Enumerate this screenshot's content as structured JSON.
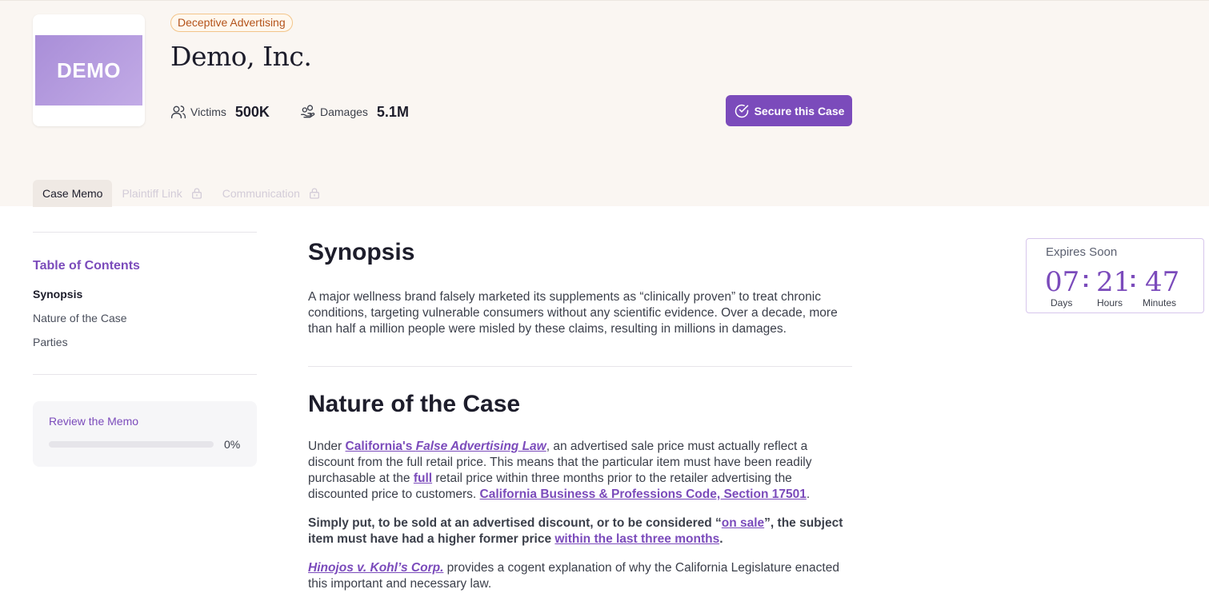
{
  "header": {
    "logo_text": "DEMO",
    "badge": "Deceptive Advertising",
    "company": "Demo, Inc.",
    "stats": [
      {
        "label": "Victims",
        "value": "500K",
        "icon": "users-icon"
      },
      {
        "label": "Damages",
        "value": "5.1M",
        "icon": "hand-coins-icon"
      }
    ],
    "secure_button": "Secure this Case"
  },
  "tabs": [
    {
      "label": "Case Memo",
      "active": true,
      "locked": false
    },
    {
      "label": "Plaintiff Link",
      "active": false,
      "locked": true
    },
    {
      "label": "Communication",
      "active": false,
      "locked": true
    }
  ],
  "toc": {
    "title": "Table of Contents",
    "items": [
      "Synopsis",
      "Nature of the Case",
      "Parties"
    ]
  },
  "review": {
    "title": "Review the Memo",
    "progress": 0,
    "progress_label": "0%"
  },
  "content": {
    "synopsis": {
      "heading": "Synopsis",
      "text": "A major wellness brand falsely marketed its supplements as “clinically proven” to treat chronic conditions, targeting vulnerable consumers without any scientific evidence. Over a decade, more than half a million people were misled by these claims, resulting in millions in damages."
    },
    "nature": {
      "heading": "Nature of the Case",
      "p1_a": "Under ",
      "p1_link1": "California's ",
      "p1_link1_italic": "False Advertising Law",
      "p1_b": ", an advertised sale price must actually reflect a discount from the full retail price. This means that the particular item must have been readily purchasable at the ",
      "p1_link2": "full",
      "p1_c": " retail price within three months prior to the retailer advertising the discounted price to customers. ",
      "p1_link3": "California Business & Professions Code, Section 17501",
      "p1_d": ".",
      "p2_a": "Simply put, to be sold at an advertised discount, or to be considered “",
      "p2_link1": "on sale",
      "p2_b": "”, the subject item must have had a higher former price ",
      "p2_link2": "within the last three months",
      "p2_c": ".",
      "p3_link": "Hinojos v. Kohl’s Corp.",
      "p3_a": " provides a cogent explanation of why the California Legislature enacted this important and necessary law."
    }
  },
  "expires": {
    "title": "Expires Soon",
    "days": "07",
    "hours": "21",
    "minutes": "47",
    "days_label": "Days",
    "hours_label": "Hours",
    "minutes_label": "Minutes",
    "separator": ":"
  },
  "colors": {
    "accent": "#7b4bbb",
    "header_bg": "#faf6f2",
    "badge_text": "#b4531a",
    "badge_border": "#f3c58a"
  }
}
